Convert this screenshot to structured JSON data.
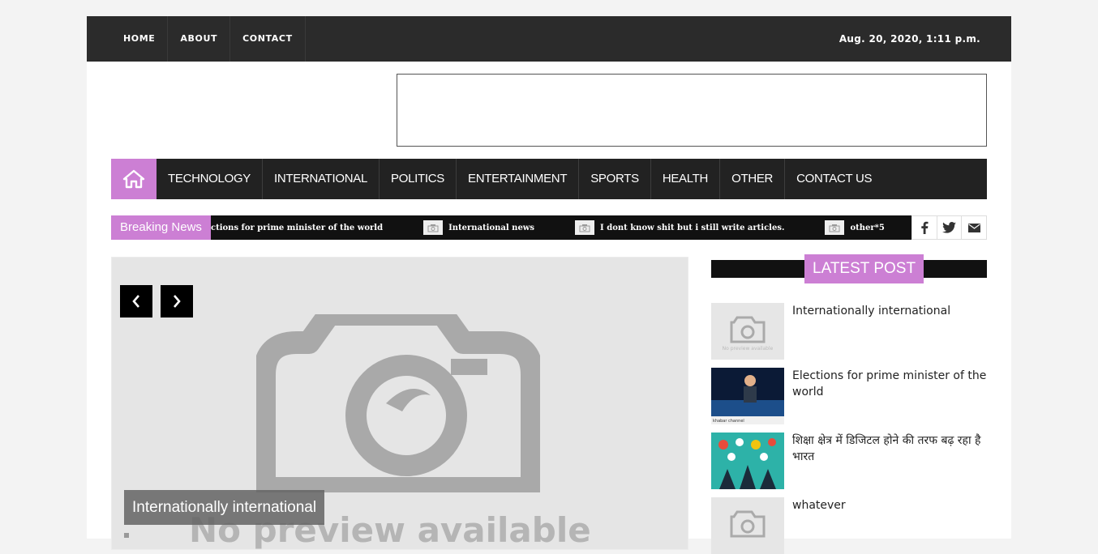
{
  "topbar": {
    "nav": [
      "HOME",
      "ABOUT",
      "CONTACT"
    ],
    "date": "Aug. 20, 2020, 1:11 p.m."
  },
  "mainnav": {
    "items": [
      "TECHNOLOGY",
      "INTERNATIONAL",
      "POLITICS",
      "ENTERTAINMENT",
      "SPORTS",
      "HEALTH",
      "OTHER",
      "CONTACT US"
    ]
  },
  "breaking": {
    "label": "Breaking News",
    "items": [
      "ctions for prime minister of the world",
      "International news",
      "I dont know shit but i still write articles.",
      "other*5"
    ]
  },
  "slider": {
    "caption": "Internationally international",
    "placeholder_text": "No preview available"
  },
  "latest": {
    "heading": "LATEST POST",
    "posts": [
      {
        "title": "Internationally international",
        "thumb": "no-preview"
      },
      {
        "title": "Elections for prime minister of the world",
        "thumb": "photo-stage"
      },
      {
        "title": "शिक्षा क्षेत्र में डिजिटल होने की तरफ बढ़ रहा है भारत",
        "thumb": "photo-digital"
      },
      {
        "title": "whatever",
        "thumb": "no-preview"
      }
    ]
  },
  "colors": {
    "accent": "#cc7fd4",
    "dark": "#2b2b2b"
  }
}
